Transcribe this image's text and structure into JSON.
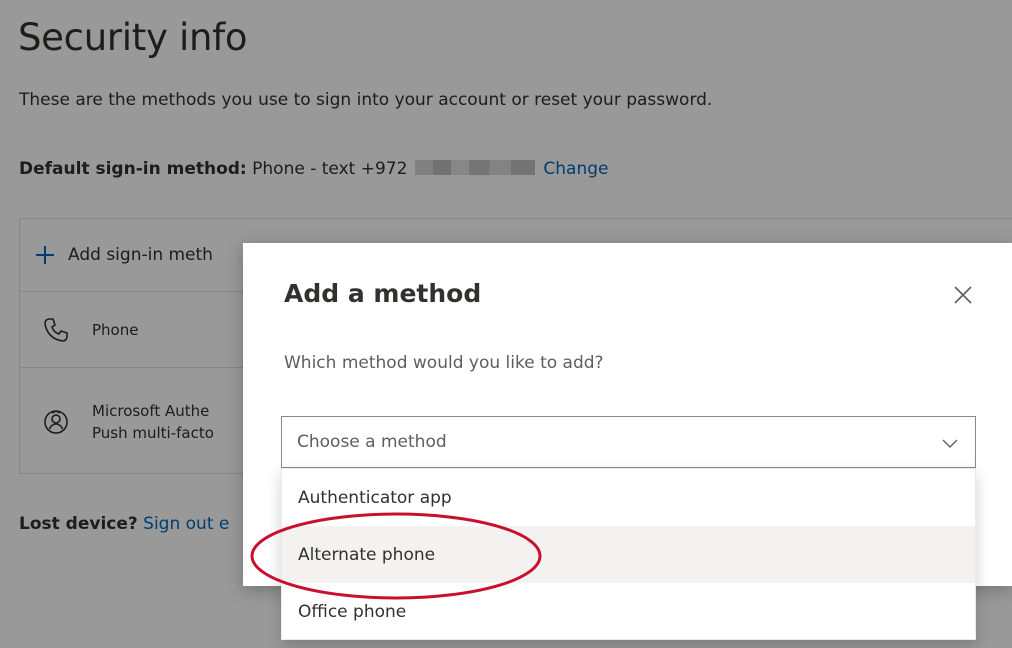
{
  "page": {
    "title": "Security info",
    "subtitle": "These are the methods you use to sign into your account or reset your password.",
    "default_label": "Default sign-in method:",
    "default_value": "Phone - text +972",
    "change_link": "Change",
    "add_method_label": "Add sign-in meth",
    "methods": [
      {
        "icon": "phone-icon",
        "line1": "Phone"
      },
      {
        "icon": "authenticator-icon",
        "line1": "Microsoft Authe",
        "line2": "Push multi-facto"
      }
    ],
    "lost_label": "Lost device?",
    "lost_link": "Sign out e"
  },
  "dialog": {
    "title": "Add a method",
    "question": "Which method would you like to add?",
    "select_placeholder": "Choose a method",
    "options": [
      "Authenticator app",
      "Alternate phone",
      "Office phone"
    ],
    "hovered_option": "Alternate phone"
  },
  "colors": {
    "link": "#0067b8",
    "annotation": "#c8102e",
    "hover": "#f3f2f1"
  }
}
